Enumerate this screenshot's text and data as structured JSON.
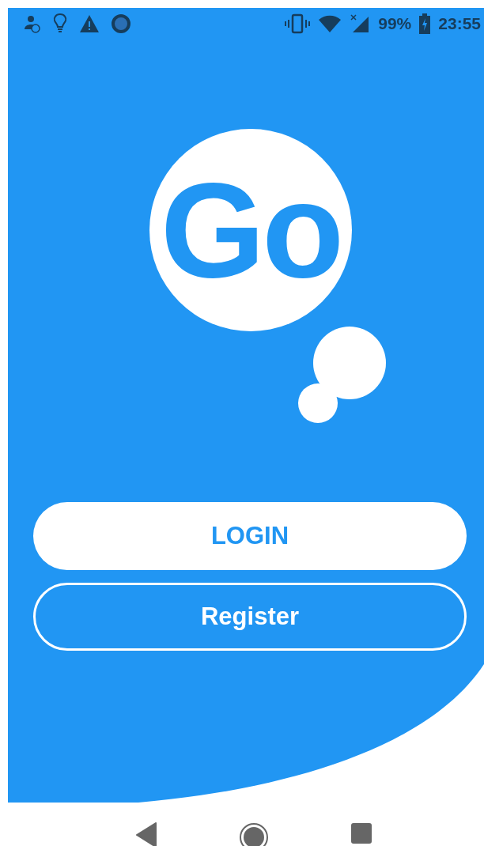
{
  "status_bar": {
    "battery": "99%",
    "time": "23:55"
  },
  "logo": {
    "text": "Go"
  },
  "buttons": [
    {
      "label": "LOGIN",
      "kind": "filled"
    },
    {
      "label": "Register",
      "kind": "outlined"
    }
  ]
}
